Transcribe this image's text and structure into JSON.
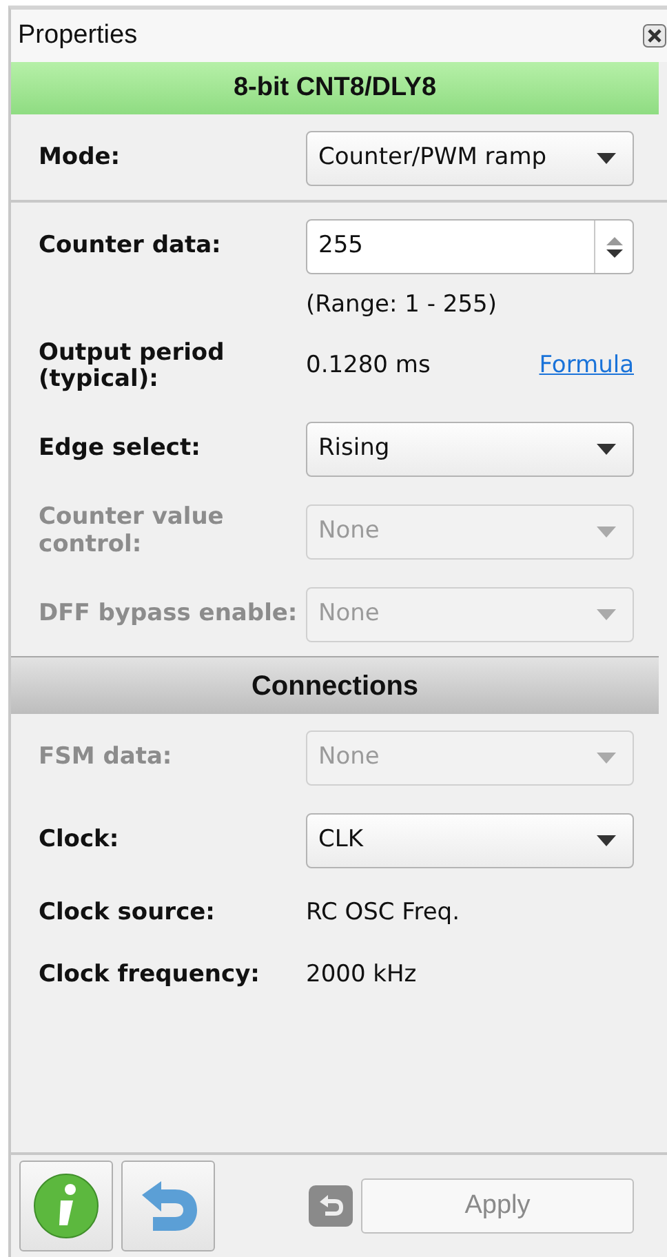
{
  "panel": {
    "title": "Properties"
  },
  "header": {
    "title": "8-bit CNT8/DLY8"
  },
  "sections": [
    {
      "rows": [
        {
          "kind": "select",
          "label": "Mode:",
          "value": "Counter/PWM ramp",
          "disabled": false
        }
      ]
    },
    {
      "rows": [
        {
          "kind": "spin",
          "label": "Counter data:",
          "value": "255",
          "disabled": false
        },
        {
          "kind": "note",
          "text": "(Range:  1 - 255)"
        },
        {
          "kind": "value",
          "label": "Output period (typical):",
          "value": "0.1280 ms",
          "link": "Formula"
        },
        {
          "kind": "select",
          "label": "Edge select:",
          "value": "Rising",
          "disabled": false
        },
        {
          "kind": "select",
          "label": "Counter value control:",
          "value": "None",
          "disabled": true
        },
        {
          "kind": "select",
          "label": "DFF bypass enable:",
          "value": "None",
          "disabled": true
        }
      ]
    },
    {
      "title": "Connections",
      "rows": [
        {
          "kind": "select",
          "label": "FSM data:",
          "value": "None",
          "disabled": true
        },
        {
          "kind": "select",
          "label": "Clock:",
          "value": "CLK",
          "disabled": false
        },
        {
          "kind": "value",
          "label": "Clock source:",
          "value": "RC OSC Freq."
        },
        {
          "kind": "value",
          "label": "Clock frequency:",
          "value": "2000 kHz"
        }
      ]
    }
  ],
  "footer": {
    "revert_disabled": true,
    "apply": {
      "label": "Apply",
      "disabled": true
    }
  }
}
